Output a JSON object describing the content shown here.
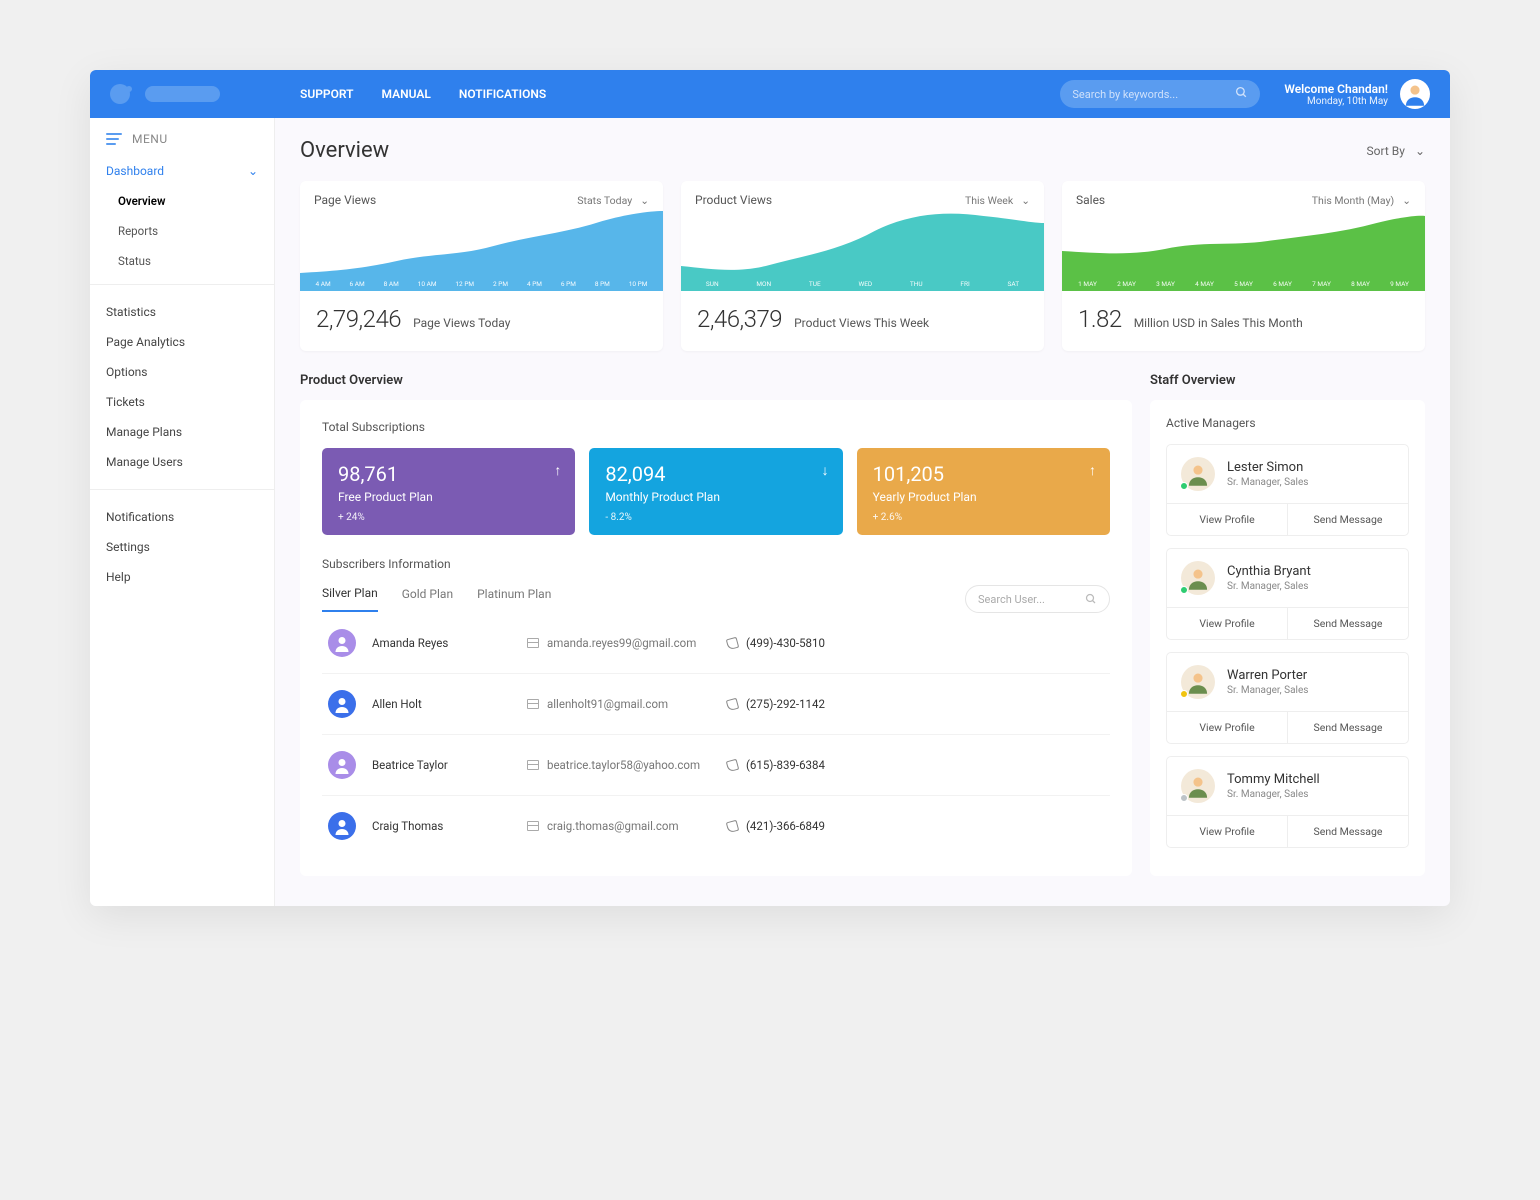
{
  "header": {
    "nav": {
      "support": "SUPPORT",
      "manual": "MANUAL",
      "notifications": "NOTIFICATIONS"
    },
    "search_placeholder": "Search by keywords...",
    "welcome": "Welcome Chandan!",
    "date": "Monday, 10th May"
  },
  "sidebar": {
    "menu_label": "MENU",
    "dashboard": "Dashboard",
    "dashboard_items": {
      "overview": "Overview",
      "reports": "Reports",
      "status": "Status"
    },
    "group2": {
      "statistics": "Statistics",
      "page_analytics": "Page Analytics",
      "options": "Options",
      "tickets": "Tickets",
      "manage_plans": "Manage Plans",
      "manage_users": "Manage Users"
    },
    "group3": {
      "notifications": "Notifications",
      "settings": "Settings",
      "help": "Help"
    }
  },
  "page": {
    "title": "Overview",
    "sort": "Sort By"
  },
  "stats": {
    "pv": {
      "title": "Page Views",
      "dd": "Stats Today",
      "value": "2,79,246",
      "label": "Page Views Today",
      "xlabels": [
        "4 AM",
        "6 AM",
        "8 AM",
        "10 AM",
        "12 PM",
        "2 PM",
        "4 PM",
        "6 PM",
        "8 PM",
        "10 PM"
      ]
    },
    "prod": {
      "title": "Product Views",
      "dd": "This Week",
      "value": "2,46,379",
      "label": "Product Views This Week",
      "xlabels": [
        "SUN",
        "MON",
        "TUE",
        "WED",
        "THU",
        "FRI",
        "SAT"
      ]
    },
    "sales": {
      "title": "Sales",
      "dd": "This Month (May)",
      "value": "1.82",
      "label": "Million USD in Sales This Month",
      "xlabels": [
        "1 MAY",
        "2 MAY",
        "3 MAY",
        "4 MAY",
        "5 MAY",
        "6 MAY",
        "7 MAY",
        "8 MAY",
        "9 MAY"
      ]
    }
  },
  "chart_data": [
    {
      "type": "area",
      "title": "Page Views",
      "categories": [
        "4 AM",
        "6 AM",
        "8 AM",
        "10 AM",
        "12 PM",
        "2 PM",
        "4 PM",
        "6 PM",
        "8 PM",
        "10 PM"
      ],
      "values": [
        20,
        25,
        30,
        35,
        32,
        40,
        55,
        60,
        75,
        95
      ],
      "ylim": [
        0,
        100
      ],
      "color": "#57b6ea"
    },
    {
      "type": "area",
      "title": "Product Views",
      "categories": [
        "SUN",
        "MON",
        "TUE",
        "WED",
        "THU",
        "FRI",
        "SAT"
      ],
      "values": [
        35,
        20,
        40,
        50,
        80,
        95,
        85
      ],
      "ylim": [
        0,
        100
      ],
      "color": "#49c9c5"
    },
    {
      "type": "area",
      "title": "Sales",
      "categories": [
        "1 MAY",
        "2 MAY",
        "3 MAY",
        "4 MAY",
        "5 MAY",
        "6 MAY",
        "7 MAY",
        "8 MAY",
        "9 MAY"
      ],
      "values": [
        55,
        50,
        45,
        60,
        55,
        65,
        60,
        75,
        90
      ],
      "ylim": [
        0,
        100
      ],
      "color": "#5bc146"
    }
  ],
  "product": {
    "section": "Product Overview",
    "total_subs": "Total Subscriptions",
    "plans": {
      "free": {
        "value": "98,761",
        "name": "Free Product Plan",
        "delta": "+ 24%",
        "dir": "up"
      },
      "month": {
        "value": "82,094",
        "name": "Monthly Product Plan",
        "delta": "- 8.2%",
        "dir": "down"
      },
      "year": {
        "value": "101,205",
        "name": "Yearly Product Plan",
        "delta": "+ 2.6%",
        "dir": "up"
      }
    },
    "subs_info": "Subscribers Information",
    "tabs": {
      "silver": "Silver Plan",
      "gold": "Gold Plan",
      "platinum": "Platinum Plan"
    },
    "search_placeholder": "Search User...",
    "rows": [
      {
        "name": "Amanda Reyes",
        "email": "amanda.reyes99@gmail.com",
        "phone": "(499)-430-5810",
        "av": "#a98de8"
      },
      {
        "name": "Allen Holt",
        "email": "allenholt91@gmail.com",
        "phone": "(275)-292-1142",
        "av": "#3b6fea"
      },
      {
        "name": "Beatrice Taylor",
        "email": "beatrice.taylor58@yahoo.com",
        "phone": "(615)-839-6384",
        "av": "#a98de8"
      },
      {
        "name": "Craig Thomas",
        "email": "craig.thomas@gmail.com",
        "phone": "(421)-366-6849",
        "av": "#3b6fea"
      }
    ]
  },
  "staff": {
    "section": "Staff Overview",
    "active": "Active Managers",
    "view": "View Profile",
    "send": "Send Message",
    "list": [
      {
        "name": "Lester Simon",
        "role": "Sr. Manager, Sales",
        "status": "#2ecc71"
      },
      {
        "name": "Cynthia Bryant",
        "role": "Sr. Manager, Sales",
        "status": "#2ecc71"
      },
      {
        "name": "Warren Porter",
        "role": "Sr. Manager, Sales",
        "status": "#f1c40f"
      },
      {
        "name": "Tommy Mitchell",
        "role": "Sr. Manager, Sales",
        "status": "#bdc3c7"
      }
    ]
  }
}
